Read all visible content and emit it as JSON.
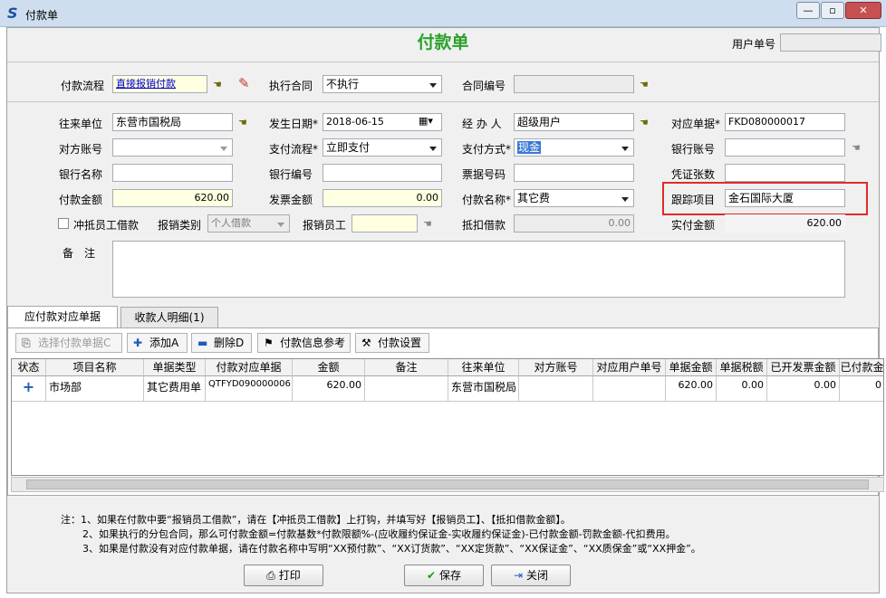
{
  "window": {
    "title": "付款单"
  },
  "form": {
    "title": "付款单",
    "user_doc_no_label": "用户单号",
    "user_doc_no_value": ""
  },
  "fields": {
    "payment_flow": {
      "label": "付款流程",
      "value": "直接报销付款"
    },
    "exec_contract": {
      "label": "执行合同",
      "value": "不执行"
    },
    "contract_no": {
      "label": "合同编号",
      "value": ""
    },
    "counterparty": {
      "label": "往来单位",
      "value": "东营市国税局"
    },
    "occur_date": {
      "label": "发生日期*",
      "value": "2018-06-15"
    },
    "handler": {
      "label": "经 办 人",
      "value": "超级用户"
    },
    "ref_doc": {
      "label": "对应单据*",
      "value": "FKD080000017"
    },
    "opp_account": {
      "label": "对方账号",
      "value": ""
    },
    "pay_flow": {
      "label": "支付流程*",
      "value": "立即支付"
    },
    "pay_method": {
      "label": "支付方式*",
      "value": "现金"
    },
    "bank_account": {
      "label": "银行账号",
      "value": ""
    },
    "bank_name": {
      "label": "银行名称",
      "value": ""
    },
    "bank_no": {
      "label": "银行编号",
      "value": ""
    },
    "bill_no": {
      "label": "票据号码",
      "value": ""
    },
    "voucher_count": {
      "label": "凭证张数",
      "value": ""
    },
    "pay_amount": {
      "label": "付款金额",
      "value": "620.00"
    },
    "invoice_amount": {
      "label": "发票金额",
      "value": "0.00"
    },
    "pay_name": {
      "label": "付款名称*",
      "value": "其它费"
    },
    "track_item": {
      "label": "跟踪项目",
      "value": "金石国际大厦"
    },
    "offset_loan": {
      "label": "冲抵员工借款"
    },
    "reimb_type": {
      "label": "报销类别",
      "value": "个人借款"
    },
    "reimb_staff": {
      "label": "报销员工",
      "value": ""
    },
    "deduct_loan": {
      "label": "抵扣借款",
      "value": "0.00"
    },
    "actual_amount": {
      "label": "实付金额",
      "value": "620.00"
    },
    "remark": {
      "label": "备　注",
      "value": ""
    }
  },
  "tabs": [
    {
      "label": "应付款对应单据",
      "active": true
    },
    {
      "label": "收款人明细(1)",
      "active": false
    }
  ],
  "toolbar": {
    "select_docs": "选择付款单据C",
    "add": "添加A",
    "delete": "删除D",
    "pay_info_ref": "付款信息参考",
    "pay_settings": "付款设置"
  },
  "grid": {
    "columns": [
      "状态",
      "项目名称",
      "单据类型",
      "付款对应单据",
      "金额",
      "备注",
      "往来单位",
      "对方账号",
      "对应用户单号",
      "单据金额",
      "单据税额",
      "已开发票金额",
      "已付款金"
    ],
    "rows": [
      [
        "+",
        "市场部",
        "其它费用单",
        "QTFYD090000006",
        "620.00",
        "",
        "东营市国税局",
        "",
        "",
        "620.00",
        "0.00",
        "0.00",
        "0"
      ]
    ]
  },
  "notes": [
    "注：1、如果在付款中要“报销员工借款”，请在【冲抵员工借款】上打钩，并填写好【报销员工】、【抵扣借款金额】。",
    "2、如果执行的分包合同，那么可付款金额=付款基数*付款限额%-(应收履约保证金-实收履约保证金)-已付款金额-罚款金额-代扣费用。",
    "3、如果是付款没有对应付款单据，请在付款名称中写明“XX预付款”、“XX订货款”、“XX定货款”、“XX保证金”、“XX质保金”或“XX押金”。"
  ],
  "buttons": {
    "print": "打印",
    "save": "保存",
    "close": "关闭"
  },
  "colors": {
    "title_green": "#2aa12a",
    "highlight_red": "#e02a2a",
    "input_yellow": "#ffffe1"
  }
}
